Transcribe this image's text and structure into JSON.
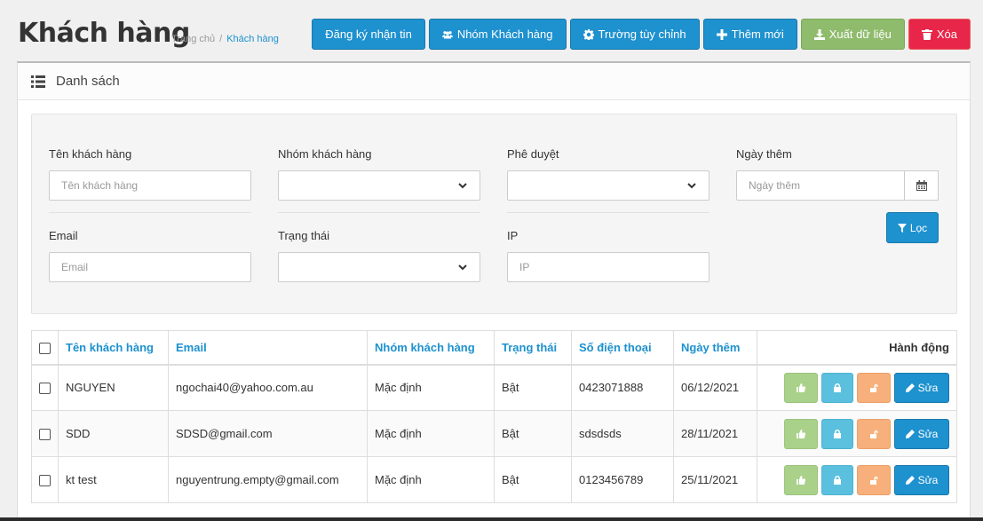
{
  "header": {
    "title": "Khách hàng",
    "breadcrumb": [
      "Trang chủ",
      "Khách hàng"
    ],
    "breadcrumb_separator": "/"
  },
  "toolbar": {
    "subscribe_label": "Đăng ký nhận tin",
    "groups_label": "Nhóm Khách hàng",
    "custom_fields_label": "Trường tùy chỉnh",
    "add_label": "Thêm mới",
    "export_label": "Xuất dữ liệu",
    "delete_label": "Xóa"
  },
  "panel": {
    "title": "Danh sách"
  },
  "filters": {
    "name_label": "Tên khách hàng",
    "name_placeholder": "Tên khách hàng",
    "group_label": "Nhóm khách hàng",
    "approval_label": "Phê duyệt",
    "date_label": "Ngày thêm",
    "date_placeholder": "Ngày thêm",
    "email_label": "Email",
    "email_placeholder": "Email",
    "status_label": "Trạng thái",
    "ip_label": "IP",
    "ip_placeholder": "IP",
    "filter_button": "Lọc"
  },
  "table": {
    "columns": [
      "Tên khách hàng",
      "Email",
      "Nhóm khách hàng",
      "Trạng thái",
      "Số điện thoại",
      "Ngày thêm",
      "Hành động"
    ],
    "rows": [
      {
        "name": "NGUYEN",
        "email": "ngochai40@yahoo.com.au",
        "group": "Mặc định",
        "status": "Bật",
        "phone": "0423071888",
        "date": "06/12/2021"
      },
      {
        "name": "SDD",
        "email": "SDSD@gmail.com",
        "group": "Mặc định",
        "status": "Bật",
        "phone": "sdsdsds",
        "date": "28/11/2021"
      },
      {
        "name": "kt test",
        "email": "nguyentrung.empty@gmail.com",
        "group": "Mặc định",
        "status": "Bật",
        "phone": "0123456789",
        "date": "25/11/2021"
      }
    ],
    "edit_label": "Sửa"
  },
  "colors": {
    "primary": "#1e91cf",
    "success": "#8fbb6c",
    "danger": "#e8264a",
    "info": "#5bc0de",
    "warning": "#f7b07b"
  }
}
